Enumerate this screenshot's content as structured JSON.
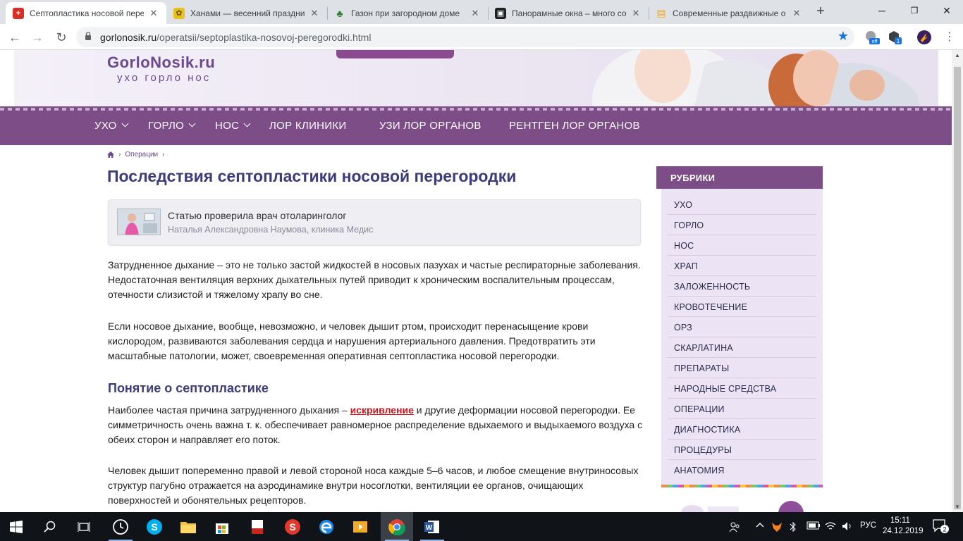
{
  "browser": {
    "tabs": [
      {
        "title": "Септопластика носовой пере",
        "active": true,
        "favicon_color": "#d93025",
        "favicon_glyph": "+"
      },
      {
        "title": "Ханами — весенний праздни",
        "active": false,
        "favicon_color": "#e8c21a",
        "favicon_glyph": "✿"
      },
      {
        "title": "Газон при загородном доме",
        "active": false,
        "favicon_color": "#2e7d32",
        "favicon_glyph": "♣"
      },
      {
        "title": "Панорамные окна – много со",
        "active": false,
        "favicon_color": "#202124",
        "favicon_glyph": "▣"
      },
      {
        "title": "Современные раздвижные о",
        "active": false,
        "favicon_color": "#f4a81d",
        "favicon_glyph": "▤"
      }
    ],
    "url_domain": "gorlonosik.ru",
    "url_path": "/operatsii/septoplastika-nosovoj-peregorodki.html",
    "extensions": {
      "off_badge": "off",
      "count_badge": "1"
    }
  },
  "site": {
    "logo_name": "GorloNosik.ru",
    "logo_tagline": "ухо горло нос",
    "nav": [
      {
        "label": "УХО",
        "dropdown": true
      },
      {
        "label": "ГОРЛО",
        "dropdown": true
      },
      {
        "label": "НОС",
        "dropdown": true
      },
      {
        "label": "ЛОР КЛИНИКИ",
        "dropdown": false
      },
      {
        "label": "УЗИ ЛОР ОРГАНОВ",
        "dropdown": false
      },
      {
        "label": "РЕНТГЕН ЛОР ОРГАНОВ",
        "dropdown": false
      }
    ],
    "breadcrumb": {
      "section": "Операции"
    }
  },
  "article": {
    "title": "Последствия септопластики носовой перегородки",
    "review_line1": "Статью проверила врач отоларинголог",
    "review_line2": "Наталья Александровна Наумова, клиника Медис",
    "p1": "Затрудненное дыхание – это не только застой жидкостей в носовых пазухах и частые респираторные заболевания. Недостаточная вентиляция верхних дыхательных путей приводит к хроническим воспалительным процессам, отечности слизистой и тяжелому храпу во сне.",
    "p2": "Если носовое дыхание, вообще, невозможно, и человек дышит ртом, происходит перенасыщение крови кислородом, развиваются заболевания сердца и нарушения артериального давления. Предотвратить эти масштабные патологии, может, своевременная оперативная септопластика носовой перегородки.",
    "h2": "Понятие о септопластике",
    "p3_before": "Наиболее частая причина затрудненного дыхания – ",
    "p3_link": "искривление",
    "p3_after": " и другие деформации носовой перегородки. Ее симметричность очень важна т. к. обеспечивает равномерное распределение вдыхаемого и выдыхаемого воздуха с обеих сторон и направляет его поток.",
    "p4": "Человек дышит попеременно правой и левой стороной носа каждые 5–6 часов, и любое смещение внутриносовых структур пагубно отражается на аэродинамике внутри носоглотки, вентиляции ее органов, очищающих поверхностей и обонятельных рецепторов."
  },
  "sidebar": {
    "title": "РУБРИКИ",
    "categories": [
      "УХО",
      "ГОРЛО",
      "НОС",
      "ХРАП",
      "ЗАЛОЖЕННОСТЬ",
      "КРОВОТЕЧЕНИЕ",
      "ОРЗ",
      "СКАРЛАТИНА",
      "ПРЕПАРАТЫ",
      "НАРОДНЫЕ СРЕДСТВА",
      "ОПЕРАЦИИ",
      "ДИАГНОСТИКА",
      "ПРОЦЕДУРЫ",
      "АНАТОМИЯ"
    ]
  },
  "taskbar": {
    "language": "РУС",
    "time": "15:11",
    "date": "24.12.2019",
    "notification_count": "2"
  },
  "colors": {
    "brand_purple": "#7d4d87",
    "heading_blue": "#3c3c7a",
    "link_red": "#d0161d"
  }
}
